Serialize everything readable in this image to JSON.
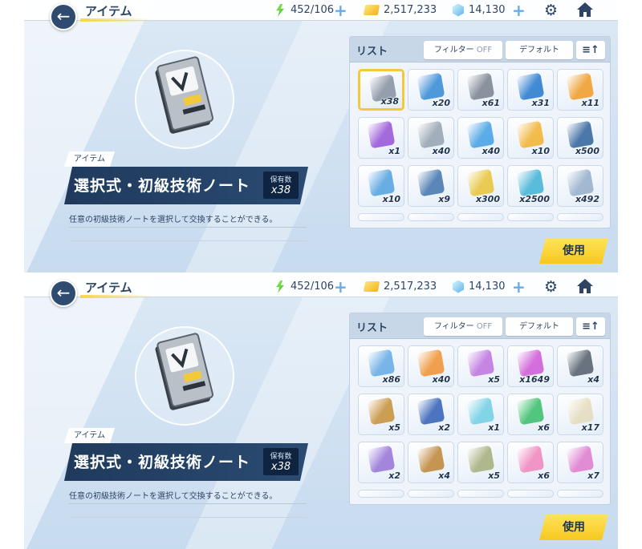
{
  "screens": [
    {
      "header": {
        "title": "アイテム",
        "ap": "452/106",
        "credits": "2,517,233",
        "gems": "14,130"
      },
      "item": {
        "category": "アイテム",
        "name": "選択式・初級技術ノート",
        "owned_label": "保有数",
        "owned_count": "x38",
        "description": "任意の初級技術ノートを選択して交換することができる。"
      },
      "list": {
        "title": "リスト",
        "filter_label": "フィルター",
        "filter_state": "OFF",
        "sort_label": "デフォルト",
        "order_icon": "≡↑"
      },
      "items": [
        {
          "count": "x38",
          "color": "#8a94a3",
          "selected": true
        },
        {
          "count": "x20",
          "color": "#3d8fd6"
        },
        {
          "count": "x61",
          "color": "#7e8794"
        },
        {
          "count": "x31",
          "color": "#2f7fd0"
        },
        {
          "count": "x11",
          "color": "#f0a030"
        },
        {
          "count": "x1",
          "color": "#9a5ad8"
        },
        {
          "count": "x40",
          "color": "#9aa6b4"
        },
        {
          "count": "x40",
          "color": "#4aa4e6"
        },
        {
          "count": "x10",
          "color": "#f2b53a"
        },
        {
          "count": "x500",
          "color": "#3a6aa0"
        },
        {
          "count": "x10",
          "color": "#5aa6e0"
        },
        {
          "count": "x9",
          "color": "#4a7ab0"
        },
        {
          "count": "x300",
          "color": "#e8c640"
        },
        {
          "count": "x2500",
          "color": "#48b6d6"
        },
        {
          "count": "x492",
          "color": "#9ab2cc"
        }
      ],
      "action": {
        "use_label": "使用"
      }
    },
    {
      "header": {
        "title": "アイテム",
        "ap": "452/106",
        "credits": "2,517,233",
        "gems": "14,130"
      },
      "item": {
        "category": "アイテム",
        "name": "選択式・初級技術ノート",
        "owned_label": "保有数",
        "owned_count": "x38",
        "description": "任意の初級技術ノートを選択して交換することができる。"
      },
      "list": {
        "title": "リスト",
        "filter_label": "フィルター",
        "filter_state": "OFF",
        "sort_label": "デフォルト",
        "order_icon": "≡↑"
      },
      "items": [
        {
          "count": "x86",
          "color": "#6aaee6"
        },
        {
          "count": "x40",
          "color": "#f0963a"
        },
        {
          "count": "x5",
          "color": "#c07ae0"
        },
        {
          "count": "x1649",
          "color": "#d060d8"
        },
        {
          "count": "x4",
          "color": "#5a6470"
        },
        {
          "count": "x5",
          "color": "#c89440"
        },
        {
          "count": "x2",
          "color": "#3a66b8"
        },
        {
          "count": "x1",
          "color": "#78d0e6"
        },
        {
          "count": "x6",
          "color": "#40c070"
        },
        {
          "count": "x17",
          "color": "#e6dcc0"
        },
        {
          "count": "x2",
          "color": "#9a7ad8"
        },
        {
          "count": "x4",
          "color": "#c08a40"
        },
        {
          "count": "x5",
          "color": "#a8b080"
        },
        {
          "count": "x6",
          "color": "#f08ac0"
        },
        {
          "count": "x7",
          "color": "#e080d0"
        }
      ],
      "action": {
        "use_label": "使用"
      }
    }
  ]
}
